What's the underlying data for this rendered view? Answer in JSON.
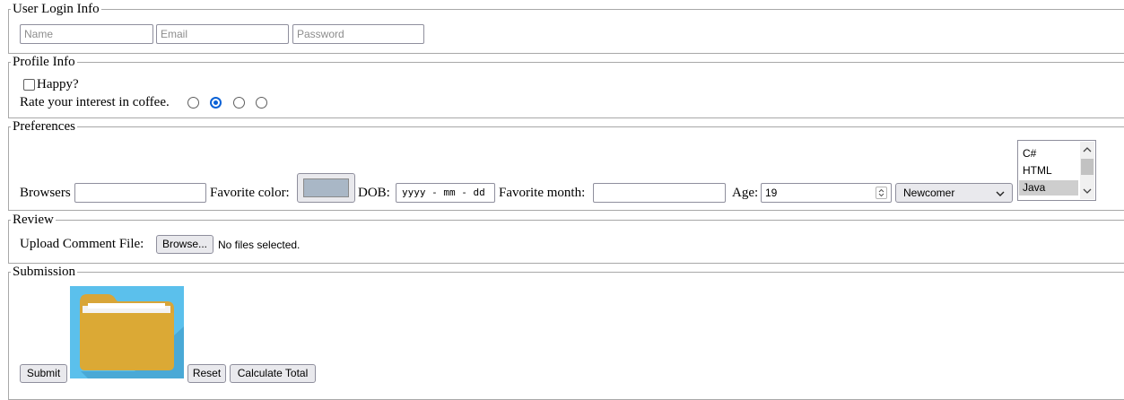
{
  "login": {
    "legend": "User Login Info",
    "name_placeholder": "Name",
    "email_placeholder": "Email",
    "password_placeholder": "Password"
  },
  "profile": {
    "legend": "Profile Info",
    "happy_label": "Happy?",
    "coffee_label": "Rate your interest in coffee.",
    "coffee_options": 4,
    "coffee_selected_index": 1
  },
  "preferences": {
    "legend": "Preferences",
    "browsers_label": "Browsers",
    "browsers_value": "",
    "color_label": "Favorite color:",
    "color_value": "#a9b7c6",
    "dob_label": "DOB:",
    "dob_placeholder": "yyyy - mm - dd",
    "month_label": "Favorite month:",
    "month_value": "",
    "age_label": "Age:",
    "age_value": "19",
    "level_selected": "Newcomer",
    "languages": [
      "C#",
      "HTML",
      "Java"
    ],
    "languages_selected": "Java"
  },
  "review": {
    "legend": "Review",
    "upload_label": "Upload Comment File:",
    "browse_label": "Browse...",
    "file_status": "No files selected."
  },
  "submission": {
    "legend": "Submission",
    "submit_label": "Submit",
    "reset_label": "Reset",
    "calculate_label": "Calculate Total"
  },
  "icons": {
    "image_button": "folder-icon",
    "spinner": "spinner-arrows-icon",
    "select": "chevron-down-icon"
  }
}
